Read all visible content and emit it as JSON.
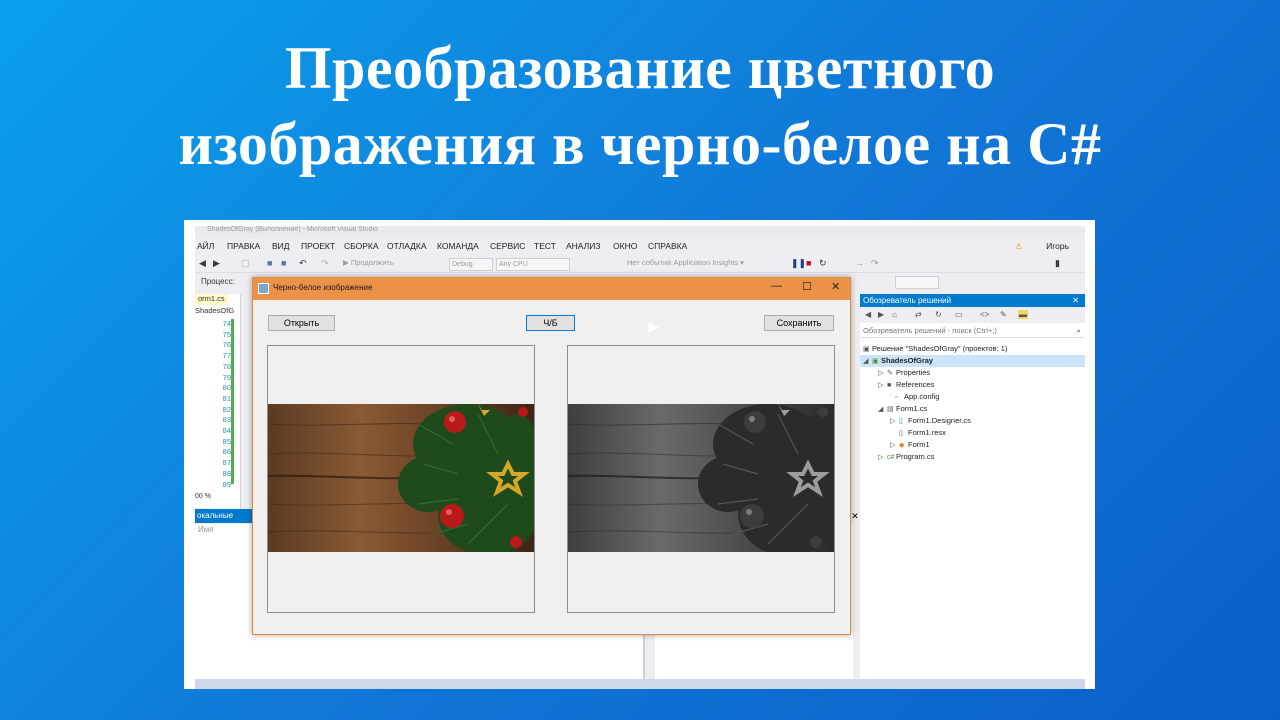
{
  "page": {
    "title_line1": "Преобразование цветного",
    "title_line2": "изображения в черно-белое на C#"
  },
  "vs": {
    "window_title": "ShadesOfGray (Выполнение) - Microsoft Visual Studio",
    "menu": [
      "АЙЛ",
      "ПРАВКА",
      "ВИД",
      "ПРОЕКТ",
      "СБОРКА",
      "ОТЛАДКА",
      "КОМАНДА",
      "СЕРВИС",
      "ТЕСТ",
      "АНАЛИЗ",
      "ОКНО",
      "СПРАВКА"
    ],
    "user": "Игорь",
    "toolbar": {
      "continue_label": "Продолжить",
      "config": "Debug",
      "platform": "Any CPU",
      "app_insights": "Нет событий Application Insights"
    },
    "process_label": "Процесс:",
    "editor": {
      "tab": "orm1.cs",
      "file_combo": "ShadesOfG",
      "line_numbers": [
        "74",
        "75",
        "76",
        "77",
        "78",
        "79",
        "80",
        "81",
        "82",
        "83",
        "84",
        "85",
        "86",
        "87",
        "88",
        "89"
      ],
      "zoom": "00 %"
    },
    "locals": {
      "title": "окальные",
      "column": "Имя"
    }
  },
  "solution_explorer": {
    "title": "Обозреватель решений",
    "search_placeholder": "Обозреватель решений - поиск (Ctrl+;)",
    "items": [
      {
        "label": "Решение \"ShadesOfGray\" (проектов: 1)"
      },
      {
        "label": "ShadesOfGray"
      },
      {
        "label": "Properties"
      },
      {
        "label": "References"
      },
      {
        "label": "App.config"
      },
      {
        "label": "Form1.cs"
      },
      {
        "label": "Form1.Designer.cs"
      },
      {
        "label": "Form1.resx"
      },
      {
        "label": "Form1"
      },
      {
        "label": "Program.cs"
      }
    ]
  },
  "dialog": {
    "title": "Черно-белое изображение",
    "open_button": "Открыть",
    "bw_button": "Ч/Б",
    "save_button": "Сохранить",
    "minimize": "—",
    "maximize": "☐",
    "close": "✕"
  },
  "colors": {
    "background_start": "#0aa0ec",
    "background_end": "#0a5fc6",
    "dialog_titlebar": "#ec9148",
    "vs_accent": "#007acc"
  }
}
